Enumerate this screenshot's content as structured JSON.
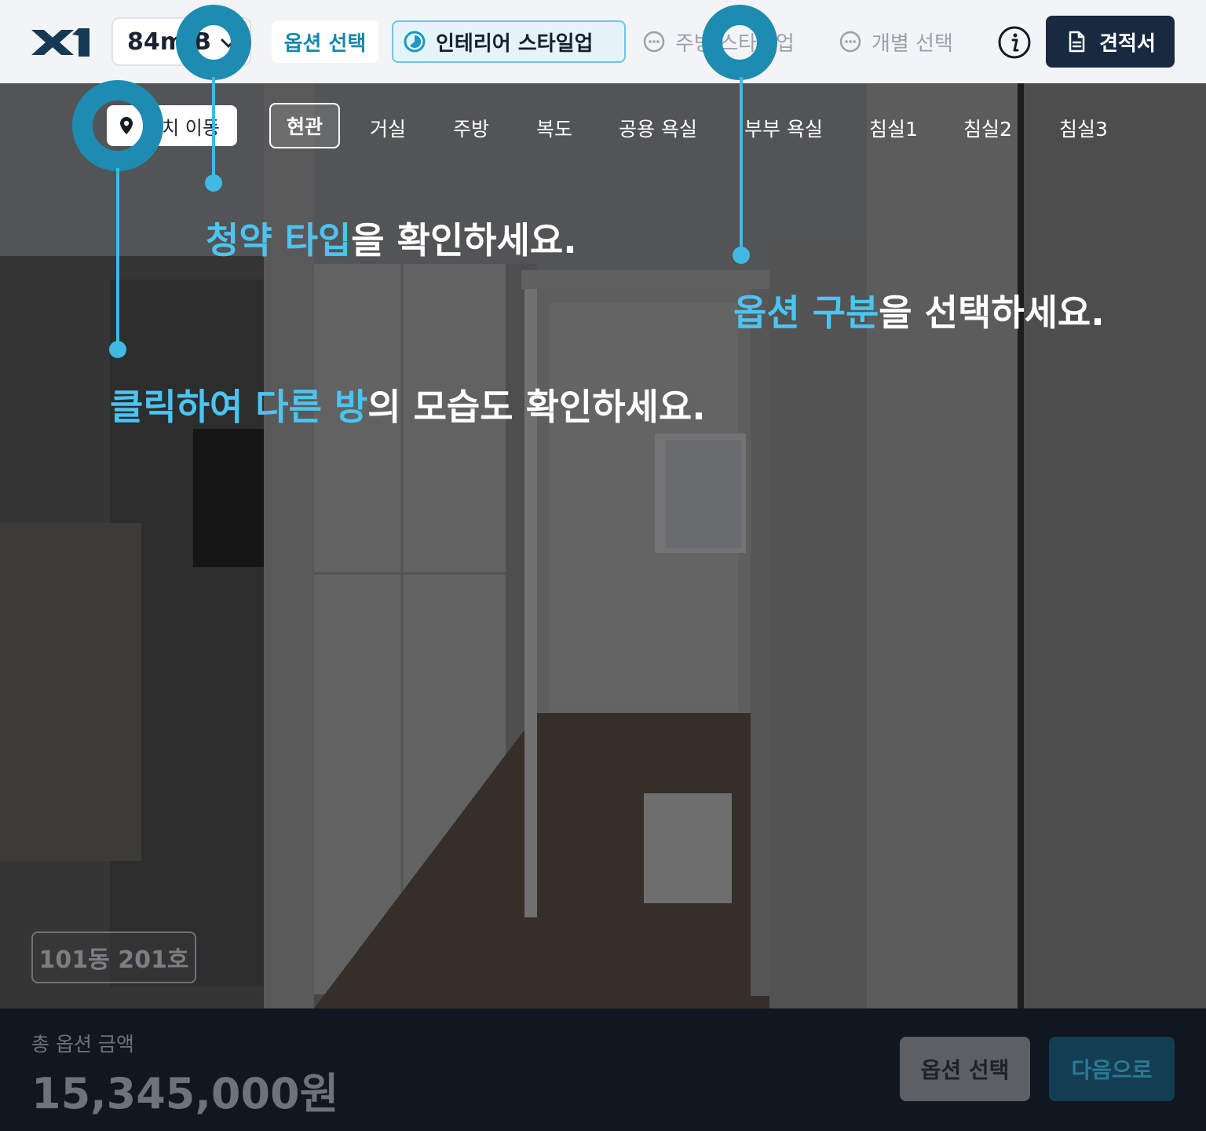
{
  "header": {
    "logo_text": "X1",
    "size_select": {
      "value": "84m",
      "sup": "2",
      "suffix": "B"
    },
    "steps": [
      {
        "label": "옵션 선택",
        "state": "done"
      },
      {
        "label": "인테리어 스타일업",
        "state": "current"
      },
      {
        "label": "주방 스타일업",
        "state": "pending"
      },
      {
        "label": "개별 선택",
        "state": "pending"
      }
    ],
    "info_icon": "info-icon",
    "quote_button": "견적서"
  },
  "room_nav": {
    "locate_label": "위치 이동",
    "rooms": [
      "현관",
      "거실",
      "주방",
      "복도",
      "공용 욕실",
      "부부 욕실",
      "침실1",
      "침실2",
      "침실3"
    ],
    "active_index": 0
  },
  "unit_badge": "101동 201호",
  "tutorial": {
    "hint_type": {
      "highlight": "청약 타입",
      "rest": "을 확인하세요."
    },
    "hint_option": {
      "highlight": "옵션 구분",
      "rest": "을 선택하세요."
    },
    "hint_room": {
      "highlight1": "클릭하여",
      "highlight2": "다른 방",
      "rest": "의 모습도 확인하세요."
    }
  },
  "footer": {
    "total_label": "총 옵션 금액",
    "total_amount": "15,345,000원",
    "option_button": "옵션 선택",
    "next_button": "다음으로"
  },
  "colors": {
    "brand_navy": "#172a40",
    "accent_blue": "#41b9e2",
    "highlight_text": "#4cc4ef"
  }
}
